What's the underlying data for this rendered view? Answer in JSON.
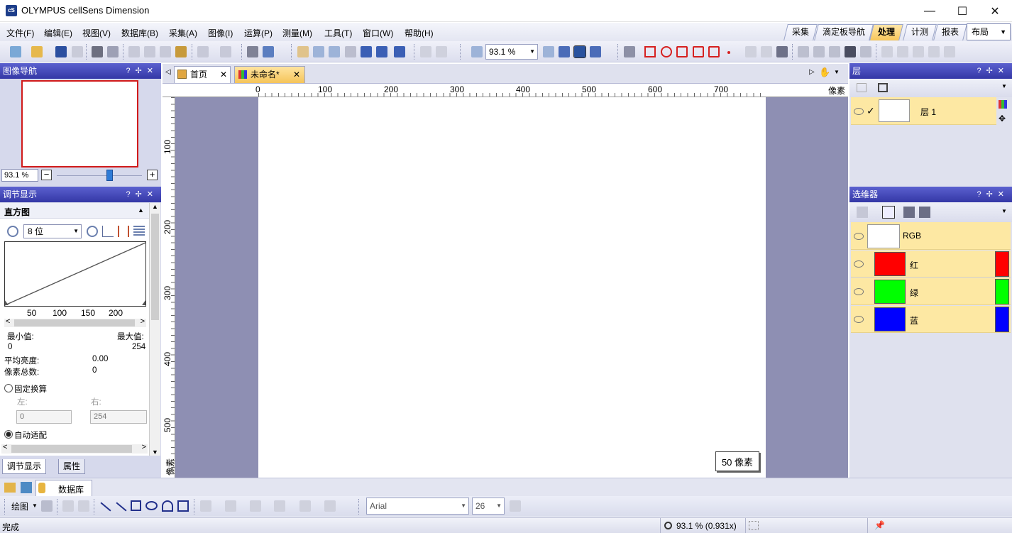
{
  "window": {
    "logo": "cS",
    "title": "OLYMPUS cellSens Dimension",
    "minimize": "—",
    "maximize": "☐",
    "close": "✕"
  },
  "menu": [
    "文件(F)",
    "编辑(E)",
    "视图(V)",
    "数据库(B)",
    "采集(A)",
    "图像(I)",
    "运算(P)",
    "测量(M)",
    "工具(T)",
    "窗口(W)",
    "帮助(H)"
  ],
  "layout_tabs": [
    "采集",
    "滴定板导航",
    "处理",
    "计测",
    "报表"
  ],
  "layout_active": "处理",
  "layout_dropdown": "布局",
  "toolbar": {
    "zoom_value": "93.1 %"
  },
  "colors": {
    "panel_header": "#4146b8",
    "canvas_bg": "#8e8fb3",
    "active_tab": "#f8c75a",
    "layer_row": "#fde8a3"
  },
  "navigator": {
    "title": "图像导航",
    "zoom": "93.1 %",
    "minus": "−",
    "plus": "+",
    "slider_level_percent": 62
  },
  "adjust": {
    "title": "调节显示",
    "histogram_title": "直方图",
    "bit_depth": "8 位",
    "x_ticks": [
      "50",
      "100",
      "150",
      "200"
    ],
    "min_label": "最小值:",
    "max_label": "最大值:",
    "min_value": "0",
    "max_value": "254",
    "avg_label": "平均亮度:",
    "avg_value": "0.00",
    "total_label": "像素总数:",
    "total_value": "0",
    "fixed_label": "固定换算",
    "left_label": "左:",
    "right_label": "右:",
    "left_value": "0",
    "right_value": "254",
    "auto_label": "自动适配"
  },
  "left_bottom_tabs": [
    "调节显示",
    "属性"
  ],
  "doc_tabs": [
    {
      "label": "首页"
    },
    {
      "label": "未命名*"
    }
  ],
  "ruler": {
    "h_ticks": [
      "0",
      "100",
      "200",
      "300",
      "400",
      "500",
      "600",
      "700"
    ],
    "v_ticks": [
      "100",
      "200",
      "300",
      "400",
      "500"
    ],
    "unit": "像素"
  },
  "scale_bar": "50 像素",
  "layers": {
    "title": "层",
    "items": [
      {
        "name": "层 1"
      }
    ]
  },
  "channels": {
    "title": "选维器",
    "items": [
      {
        "name": "RGB",
        "color": "#ffffff"
      },
      {
        "name": "红",
        "color": "#ff0000"
      },
      {
        "name": "绿",
        "color": "#00ff00"
      },
      {
        "name": "蓝",
        "color": "#0000ff"
      }
    ]
  },
  "bottom_tabs": {
    "database": "数据库"
  },
  "draw_toolbar": {
    "draw_label": "绘图",
    "font": "Arial",
    "font_size": "26"
  },
  "status": {
    "text": "完成",
    "zoom": "93.1 % (0.931x)"
  }
}
